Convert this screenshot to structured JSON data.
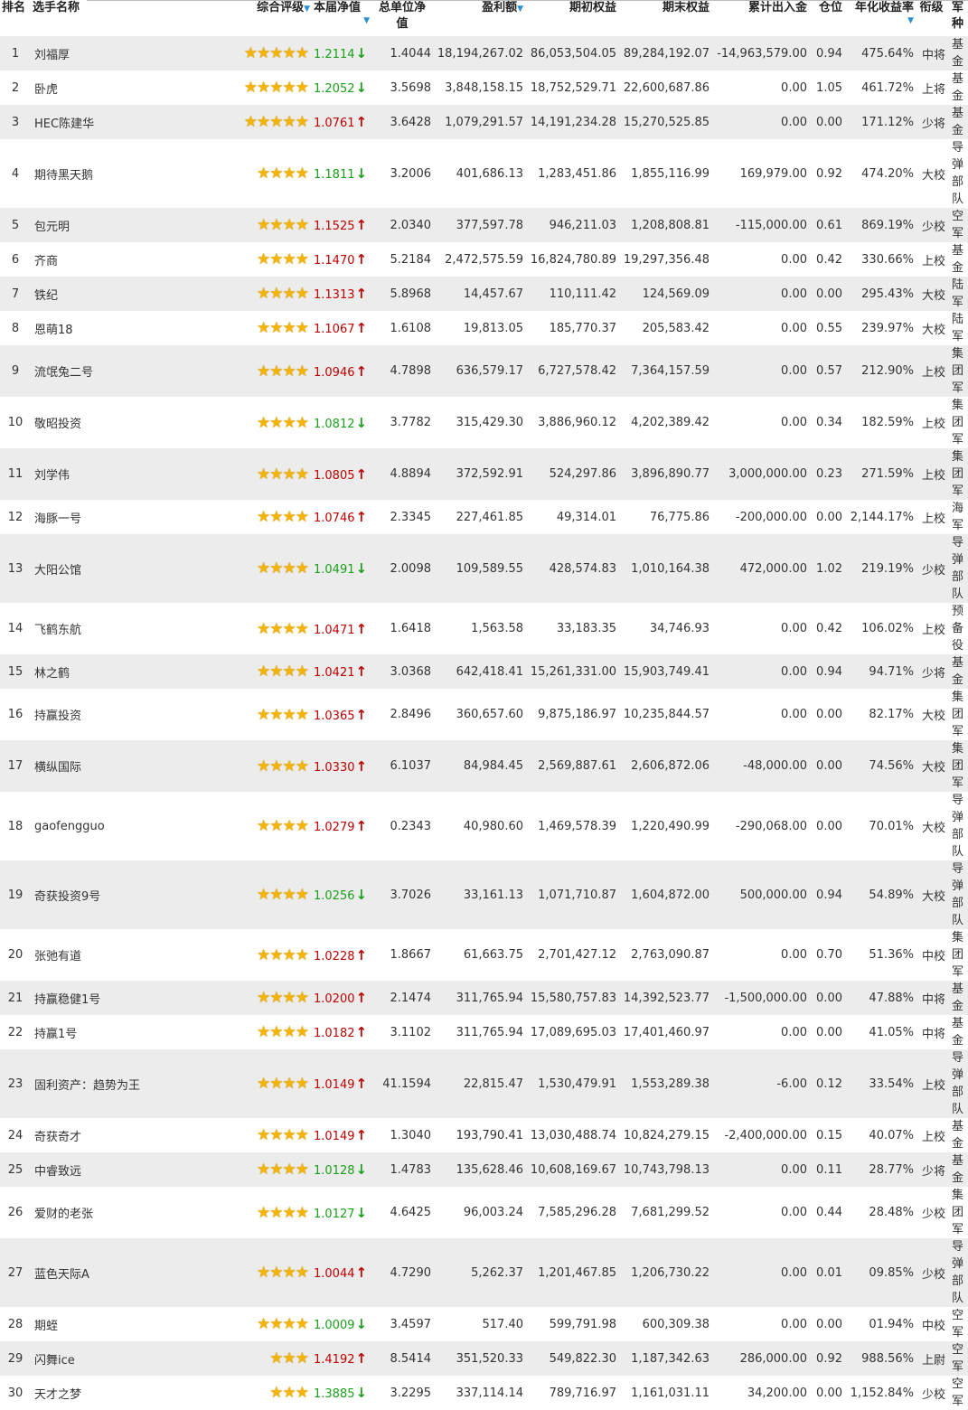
{
  "headers": {
    "rank": "排名",
    "name": "选手名称",
    "rating": "综合评级",
    "nav": "本届净值",
    "unit_nav": "总单位净值",
    "profit": "盈利额",
    "start_equity": "期初权益",
    "end_equity": "期末权益",
    "net_flow": "累计出入金",
    "position": "仓位",
    "annual_return": "年化收益率",
    "grade": "衔级",
    "army": "军种"
  },
  "sort_indicator": "▼",
  "rows": [
    {
      "rank": "1",
      "name": "刘福厚",
      "stars": 5,
      "nav": "1.2114",
      "dir": "down",
      "unit_nav": "1.4044",
      "profit": "18,194,267.02",
      "start": "86,053,504.05",
      "end": "89,284,192.07",
      "flow": "-14,963,579.00",
      "pos": "0.94",
      "annual": "475.64%",
      "grade": "中将",
      "army": "基金"
    },
    {
      "rank": "2",
      "name": "卧虎",
      "stars": 5,
      "nav": "1.2052",
      "dir": "down",
      "unit_nav": "3.5698",
      "profit": "3,848,158.15",
      "start": "18,752,529.71",
      "end": "22,600,687.86",
      "flow": "0.00",
      "pos": "1.05",
      "annual": "461.72%",
      "grade": "上将",
      "army": "基金"
    },
    {
      "rank": "3",
      "name": "HEC陈建华",
      "stars": 5,
      "nav": "1.0761",
      "dir": "up",
      "unit_nav": "3.6428",
      "profit": "1,079,291.57",
      "start": "14,191,234.28",
      "end": "15,270,525.85",
      "flow": "0.00",
      "pos": "0.00",
      "annual": "171.12%",
      "grade": "少将",
      "army": "基金"
    },
    {
      "rank": "4",
      "name": "期待黑天鹅",
      "stars": 4,
      "nav": "1.1811",
      "dir": "down",
      "unit_nav": "3.2006",
      "profit": "401,686.13",
      "start": "1,283,451.86",
      "end": "1,855,116.99",
      "flow": "169,979.00",
      "pos": "0.92",
      "annual": "474.20%",
      "grade": "大校",
      "army": "导弹部队"
    },
    {
      "rank": "5",
      "name": "包元明",
      "stars": 4,
      "nav": "1.1525",
      "dir": "up",
      "unit_nav": "2.0340",
      "profit": "377,597.78",
      "start": "946,211.03",
      "end": "1,208,808.81",
      "flow": "-115,000.00",
      "pos": "0.61",
      "annual": "869.19%",
      "grade": "少校",
      "army": "空军"
    },
    {
      "rank": "6",
      "name": "齐商",
      "stars": 4,
      "nav": "1.1470",
      "dir": "up",
      "unit_nav": "5.2184",
      "profit": "2,472,575.59",
      "start": "16,824,780.89",
      "end": "19,297,356.48",
      "flow": "0.00",
      "pos": "0.42",
      "annual": "330.66%",
      "grade": "上校",
      "army": "基金"
    },
    {
      "rank": "7",
      "name": "铁纪",
      "stars": 4,
      "nav": "1.1313",
      "dir": "up",
      "unit_nav": "5.8968",
      "profit": "14,457.67",
      "start": "110,111.42",
      "end": "124,569.09",
      "flow": "0.00",
      "pos": "0.00",
      "annual": "295.43%",
      "grade": "大校",
      "army": "陆军"
    },
    {
      "rank": "8",
      "name": "恩萌18",
      "stars": 4,
      "nav": "1.1067",
      "dir": "up",
      "unit_nav": "1.6108",
      "profit": "19,813.05",
      "start": "185,770.37",
      "end": "205,583.42",
      "flow": "0.00",
      "pos": "0.55",
      "annual": "239.97%",
      "grade": "大校",
      "army": "陆军"
    },
    {
      "rank": "9",
      "name": "流氓兔二号",
      "stars": 4,
      "nav": "1.0946",
      "dir": "up",
      "unit_nav": "4.7898",
      "profit": "636,579.17",
      "start": "6,727,578.42",
      "end": "7,364,157.59",
      "flow": "0.00",
      "pos": "0.57",
      "annual": "212.90%",
      "grade": "上校",
      "army": "集团军"
    },
    {
      "rank": "10",
      "name": "敬昭投资",
      "stars": 4,
      "nav": "1.0812",
      "dir": "down",
      "unit_nav": "3.7782",
      "profit": "315,429.30",
      "start": "3,886,960.12",
      "end": "4,202,389.42",
      "flow": "0.00",
      "pos": "0.34",
      "annual": "182.59%",
      "grade": "上校",
      "army": "集团军"
    },
    {
      "rank": "11",
      "name": "刘学伟",
      "stars": 4,
      "nav": "1.0805",
      "dir": "up",
      "unit_nav": "4.8894",
      "profit": "372,592.91",
      "start": "524,297.86",
      "end": "3,896,890.77",
      "flow": "3,000,000.00",
      "pos": "0.23",
      "annual": "271.59%",
      "grade": "上校",
      "army": "集团军"
    },
    {
      "rank": "12",
      "name": "海豚一号",
      "stars": 4,
      "nav": "1.0746",
      "dir": "up",
      "unit_nav": "2.3345",
      "profit": "227,461.85",
      "start": "49,314.01",
      "end": "76,775.86",
      "flow": "-200,000.00",
      "pos": "0.00",
      "annual": "2,144.17%",
      "grade": "上校",
      "army": "海军"
    },
    {
      "rank": "13",
      "name": "大阳公馆",
      "stars": 4,
      "nav": "1.0491",
      "dir": "down",
      "unit_nav": "2.0098",
      "profit": "109,589.55",
      "start": "428,574.83",
      "end": "1,010,164.38",
      "flow": "472,000.00",
      "pos": "1.02",
      "annual": "219.19%",
      "grade": "少校",
      "army": "导弹部队"
    },
    {
      "rank": "14",
      "name": "飞鹤东航",
      "stars": 4,
      "nav": "1.0471",
      "dir": "up",
      "unit_nav": "1.6418",
      "profit": "1,563.58",
      "start": "33,183.35",
      "end": "34,746.93",
      "flow": "0.00",
      "pos": "0.42",
      "annual": "106.02%",
      "grade": "上校",
      "army": "预备役"
    },
    {
      "rank": "15",
      "name": "林之鹤",
      "stars": 4,
      "nav": "1.0421",
      "dir": "up",
      "unit_nav": "3.0368",
      "profit": "642,418.41",
      "start": "15,261,331.00",
      "end": "15,903,749.41",
      "flow": "0.00",
      "pos": "0.94",
      "annual": "94.71%",
      "grade": "少将",
      "army": "基金"
    },
    {
      "rank": "16",
      "name": "持赢投资",
      "stars": 4,
      "nav": "1.0365",
      "dir": "up",
      "unit_nav": "2.8496",
      "profit": "360,657.60",
      "start": "9,875,186.97",
      "end": "10,235,844.57",
      "flow": "0.00",
      "pos": "0.00",
      "annual": "82.17%",
      "grade": "大校",
      "army": "集团军"
    },
    {
      "rank": "17",
      "name": "横纵国际",
      "stars": 4,
      "nav": "1.0330",
      "dir": "up",
      "unit_nav": "6.1037",
      "profit": "84,984.45",
      "start": "2,569,887.61",
      "end": "2,606,872.06",
      "flow": "-48,000.00",
      "pos": "0.00",
      "annual": "74.56%",
      "grade": "大校",
      "army": "集团军"
    },
    {
      "rank": "18",
      "name": "gaofengguo",
      "stars": 4,
      "nav": "1.0279",
      "dir": "up",
      "unit_nav": "0.2343",
      "profit": "40,980.60",
      "start": "1,469,578.39",
      "end": "1,220,490.99",
      "flow": "-290,068.00",
      "pos": "0.00",
      "annual": "70.01%",
      "grade": "大校",
      "army": "导弹部队"
    },
    {
      "rank": "19",
      "name": "奇获投资9号",
      "stars": 4,
      "nav": "1.0256",
      "dir": "down",
      "unit_nav": "3.7026",
      "profit": "33,161.13",
      "start": "1,071,710.87",
      "end": "1,604,872.00",
      "flow": "500,000.00",
      "pos": "0.94",
      "annual": "54.89%",
      "grade": "大校",
      "army": "导弹部队"
    },
    {
      "rank": "20",
      "name": "张弛有道",
      "stars": 4,
      "nav": "1.0228",
      "dir": "up",
      "unit_nav": "1.8667",
      "profit": "61,663.75",
      "start": "2,701,427.12",
      "end": "2,763,090.87",
      "flow": "0.00",
      "pos": "0.70",
      "annual": "51.36%",
      "grade": "中校",
      "army": "集团军"
    },
    {
      "rank": "21",
      "name": "持赢稳健1号",
      "stars": 4,
      "nav": "1.0200",
      "dir": "up",
      "unit_nav": "2.1474",
      "profit": "311,765.94",
      "start": "15,580,757.83",
      "end": "14,392,523.77",
      "flow": "-1,500,000.00",
      "pos": "0.00",
      "annual": "47.88%",
      "grade": "中将",
      "army": "基金"
    },
    {
      "rank": "22",
      "name": "持赢1号",
      "stars": 4,
      "nav": "1.0182",
      "dir": "up",
      "unit_nav": "3.1102",
      "profit": "311,765.94",
      "start": "17,089,695.03",
      "end": "17,401,460.97",
      "flow": "0.00",
      "pos": "0.00",
      "annual": "41.05%",
      "grade": "中将",
      "army": "基金"
    },
    {
      "rank": "23",
      "name": "固利资产：趋势为王",
      "stars": 4,
      "nav": "1.0149",
      "dir": "up",
      "unit_nav": "41.1594",
      "profit": "22,815.47",
      "start": "1,530,479.91",
      "end": "1,553,289.38",
      "flow": "-6.00",
      "pos": "0.12",
      "annual": "33.54%",
      "grade": "上校",
      "army": "导弹部队"
    },
    {
      "rank": "24",
      "name": "奇获奇才",
      "stars": 4,
      "nav": "1.0149",
      "dir": "up",
      "unit_nav": "1.3040",
      "profit": "193,790.41",
      "start": "13,030,488.74",
      "end": "10,824,279.15",
      "flow": "-2,400,000.00",
      "pos": "0.15",
      "annual": "40.07%",
      "grade": "上校",
      "army": "基金"
    },
    {
      "rank": "25",
      "name": "中睿致远",
      "stars": 4,
      "nav": "1.0128",
      "dir": "down",
      "unit_nav": "1.4783",
      "profit": "135,628.46",
      "start": "10,608,169.67",
      "end": "10,743,798.13",
      "flow": "0.00",
      "pos": "0.11",
      "annual": "28.77%",
      "grade": "少将",
      "army": "基金"
    },
    {
      "rank": "26",
      "name": "爱财的老张",
      "stars": 4,
      "nav": "1.0127",
      "dir": "down",
      "unit_nav": "4.6425",
      "profit": "96,003.24",
      "start": "7,585,296.28",
      "end": "7,681,299.52",
      "flow": "0.00",
      "pos": "0.44",
      "annual": "28.48%",
      "grade": "少校",
      "army": "集团军"
    },
    {
      "rank": "27",
      "name": "蓝色天际A",
      "stars": 4,
      "nav": "1.0044",
      "dir": "up",
      "unit_nav": "4.7290",
      "profit": "5,262.37",
      "start": "1,201,467.85",
      "end": "1,206,730.22",
      "flow": "0.00",
      "pos": "0.01",
      "annual": "09.85%",
      "grade": "少校",
      "army": "导弹部队"
    },
    {
      "rank": "28",
      "name": "期蛭",
      "stars": 4,
      "nav": "1.0009",
      "dir": "down",
      "unit_nav": "3.4597",
      "profit": "517.40",
      "start": "599,791.98",
      "end": "600,309.38",
      "flow": "0.00",
      "pos": "0.00",
      "annual": "01.94%",
      "grade": "中校",
      "army": "空军"
    },
    {
      "rank": "29",
      "name": "闪舞ice",
      "stars": 3,
      "nav": "1.4192",
      "dir": "up",
      "unit_nav": "8.5414",
      "profit": "351,520.33",
      "start": "549,822.30",
      "end": "1,187,342.63",
      "flow": "286,000.00",
      "pos": "0.92",
      "annual": "988.56%",
      "grade": "上尉",
      "army": "空军"
    },
    {
      "rank": "30",
      "name": "天才之梦",
      "stars": 3,
      "nav": "1.3885",
      "dir": "down",
      "unit_nav": "3.2295",
      "profit": "337,114.14",
      "start": "789,716.97",
      "end": "1,161,031.11",
      "flow": "34,200.00",
      "pos": "0.00",
      "annual": "1,152.84%",
      "grade": "少校",
      "army": "空军"
    }
  ]
}
